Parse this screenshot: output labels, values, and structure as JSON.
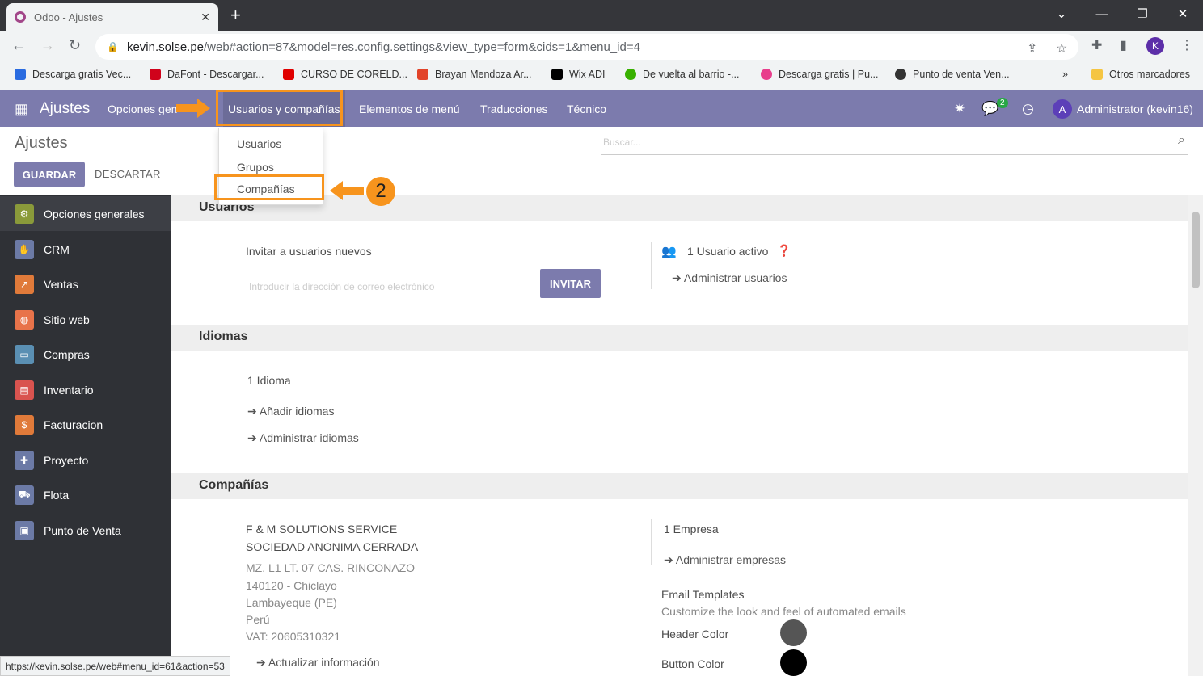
{
  "browser": {
    "tab_title": "Odoo - Ajustes",
    "url_host": "kevin.solse.pe",
    "url_path": "/web#action=87&model=res.config.settings&view_type=form&cids=1&menu_id=4",
    "profile_initial": "K",
    "bookmarks": [
      {
        "label": "Descarga gratis Vec...",
        "color": "#2a6be0"
      },
      {
        "label": "DaFont - Descargar...",
        "color": "#d0021b"
      },
      {
        "label": "CURSO DE CORELD...",
        "color": "#e00000"
      },
      {
        "label": "Brayan Mendoza Ar...",
        "color": "#e24329"
      },
      {
        "label": "Wix ADI",
        "color": "#000000"
      },
      {
        "label": "De vuelta al barrio -...",
        "color": "#38b000"
      },
      {
        "label": "Descarga gratis | Pu...",
        "color": "#e83e8c"
      },
      {
        "label": "Punto de venta Ven...",
        "color": "#333333"
      }
    ],
    "more_bookmarks": "»",
    "other_bookmarks": "Otros marcadores",
    "status_url": "https://kevin.solse.pe/web#menu_id=61&action=53"
  },
  "navbar": {
    "brand": "Ajustes",
    "items": [
      "Opciones gen",
      "Usuarios y compañías",
      "Elementos de menú",
      "Traducciones",
      "Técnico"
    ],
    "chat_badge": "2",
    "user_initial": "A",
    "user_name": "Administrator (kevin16)",
    "color": "#7c7bad"
  },
  "dropdown": {
    "items": [
      "Usuarios",
      "Grupos",
      "Compañías"
    ]
  },
  "annotation": {
    "step": "2",
    "color": "#f7941d"
  },
  "control": {
    "breadcrumb": "Ajustes",
    "save": "GUARDAR",
    "discard": "DESCARTAR",
    "search_placeholder": "Buscar..."
  },
  "sidebar": {
    "items": [
      {
        "label": "Opciones generales",
        "icon": "gear-icon",
        "color": "#8a9a3a"
      },
      {
        "label": "CRM",
        "icon": "handshake-icon",
        "color": "#6c7aa6"
      },
      {
        "label": "Ventas",
        "icon": "chart-icon",
        "color": "#e07a3a"
      },
      {
        "label": "Sitio web",
        "icon": "globe-icon",
        "color": "#e8734a"
      },
      {
        "label": "Compras",
        "icon": "card-icon",
        "color": "#5a8fb3"
      },
      {
        "label": "Inventario",
        "icon": "box-icon",
        "color": "#d9534f"
      },
      {
        "label": "Facturacion",
        "icon": "invoice-icon",
        "color": "#e07a3a"
      },
      {
        "label": "Proyecto",
        "icon": "puzzle-icon",
        "color": "#6c7aa6"
      },
      {
        "label": "Flota",
        "icon": "car-icon",
        "color": "#6c7aa6"
      },
      {
        "label": "Punto de Venta",
        "icon": "register-icon",
        "color": "#6c7aa6"
      }
    ]
  },
  "sections": {
    "usuarios": {
      "title": "Usuarios",
      "invite_label": "Invitar a usuarios nuevos",
      "invite_placeholder": "Introducir la dirección de correo electrónico",
      "invite_button": "INVITAR",
      "active_users": "1 Usuario activo",
      "manage_users": "Administrar usuarios"
    },
    "idiomas": {
      "title": "Idiomas",
      "count": "1 Idioma",
      "add": "Añadir idiomas",
      "manage": "Administrar idiomas"
    },
    "companias": {
      "title": "Compañías",
      "name1": "F & M SOLUTIONS SERVICE",
      "name2": "SOCIEDAD ANONIMA CERRADA",
      "addr1": "MZ. L1 LT. 07 CAS. RINCONAZO",
      "addr2": "140120 - Chiclayo",
      "addr3": "Lambayeque (PE)",
      "addr4": "Perú",
      "vat": "VAT: 20605310321",
      "update": "Actualizar información",
      "count": "1 Empresa",
      "manage": "Administrar empresas",
      "email_title": "Email Templates",
      "email_desc": "Customize the look and feel of automated emails",
      "header_color_label": "Header Color",
      "header_color": "#555555",
      "button_color_label": "Button Color",
      "button_color": "#000000"
    }
  }
}
